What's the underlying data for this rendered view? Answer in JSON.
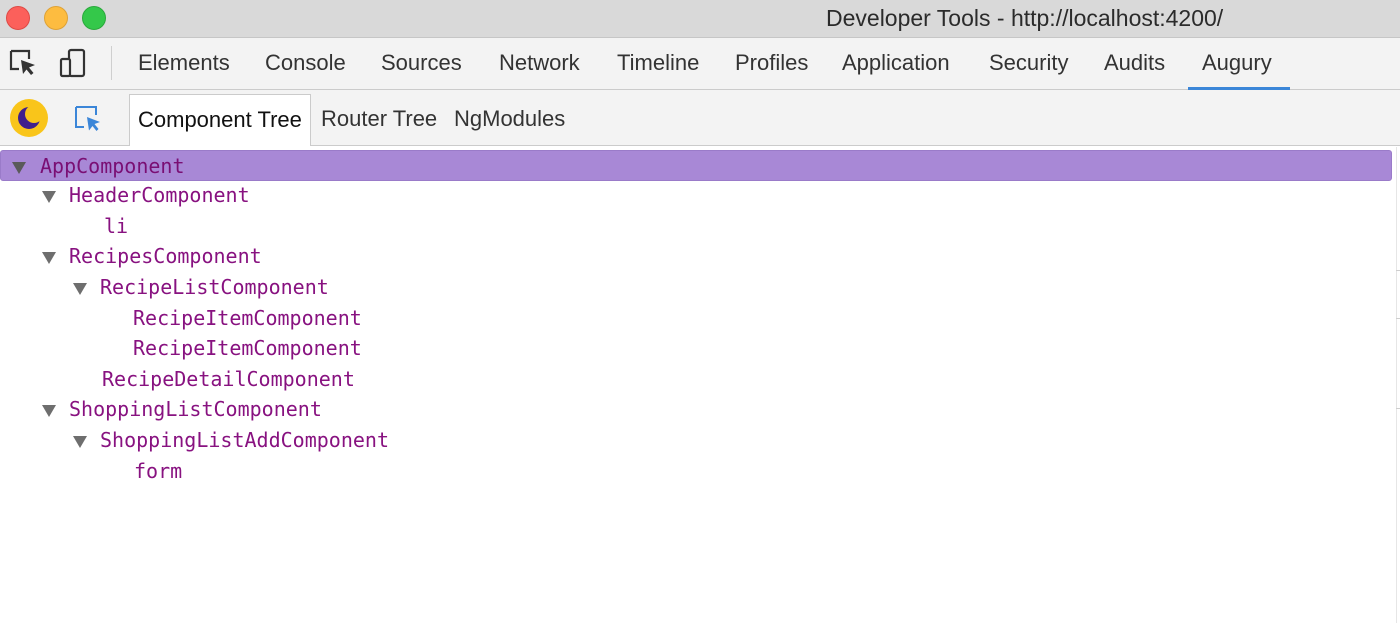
{
  "window": {
    "title": "Developer Tools - http://localhost:4200/"
  },
  "toolbar": {
    "tabs": [
      {
        "label": "Elements"
      },
      {
        "label": "Console"
      },
      {
        "label": "Sources"
      },
      {
        "label": "Network"
      },
      {
        "label": "Timeline"
      },
      {
        "label": "Profiles"
      },
      {
        "label": "Application"
      },
      {
        "label": "Security"
      },
      {
        "label": "Audits"
      },
      {
        "label": "Augury",
        "active": true
      }
    ],
    "icons": [
      "inspect-element-icon",
      "device-toolbar-icon"
    ],
    "accent_color": "#3b86d8"
  },
  "augury": {
    "logo_icon": "augury-moon-icon",
    "select_icon": "select-component-icon",
    "tabs": [
      {
        "label": "Component Tree",
        "active": true
      },
      {
        "label": "Router Tree"
      },
      {
        "label": "NgModules"
      }
    ]
  },
  "tree": {
    "node_color": "#881280",
    "selected_color": "#a888d6",
    "nodes": [
      {
        "label": "AppComponent",
        "depth": 0,
        "expanded": true,
        "selected": true
      },
      {
        "label": "HeaderComponent",
        "depth": 1,
        "expanded": true
      },
      {
        "label": "li",
        "depth": 2
      },
      {
        "label": "RecipesComponent",
        "depth": 1,
        "expanded": true
      },
      {
        "label": "RecipeListComponent",
        "depth": 2,
        "expanded": true
      },
      {
        "label": "RecipeItemComponent",
        "depth": 3
      },
      {
        "label": "RecipeItemComponent",
        "depth": 3
      },
      {
        "label": "RecipeDetailComponent",
        "depth": 2
      },
      {
        "label": "ShoppingListComponent",
        "depth": 1,
        "expanded": true
      },
      {
        "label": "ShoppingListAddComponent",
        "depth": 2,
        "expanded": true
      },
      {
        "label": "form",
        "depth": 3
      }
    ]
  }
}
